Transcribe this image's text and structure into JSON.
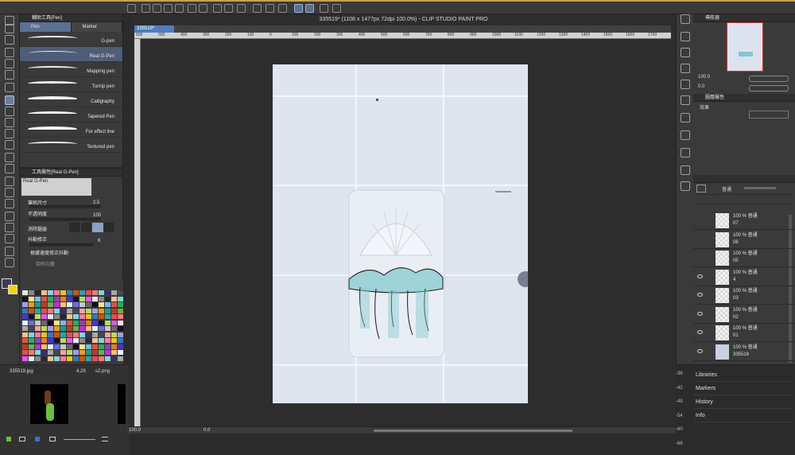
{
  "app": {
    "document_title": "335519* (1108 x 1477px 72dpi 100.0%)  - CLIP STUDIO PAINT PRO",
    "doc_tab": "335519*"
  },
  "subtool_panel": {
    "title": "輔助工具[Pen]",
    "tabs": [
      "Pen",
      "Marker"
    ],
    "active_tab": 0,
    "brushes": [
      "G-pen",
      "Real G-Pen",
      "Mapping pen",
      "Turnip pen",
      "Calligraphy",
      "Tapered Pen",
      "For effect line",
      "Textured pen"
    ],
    "active_brush": 1
  },
  "tool_property": {
    "title": "工具屬性[Real G-Pen]",
    "preview_label": "Real G-Pen",
    "brush_size_label": "筆刷尺寸",
    "brush_size_value": "2.5",
    "opacity_label": "不透明度",
    "opacity_value": "100",
    "antialias_label": "消除鋸齒",
    "stabilize_label": "抖動修正",
    "stabilize_value": "6",
    "speed_check_label": "根據速度修正抖動",
    "vector_snap_label": "吸附向量"
  },
  "ruler_ticks": [
    "600",
    "500",
    "400",
    "300",
    "200",
    "100",
    "0",
    "100",
    "200",
    "300",
    "400",
    "500",
    "600",
    "700",
    "800",
    "900",
    "1000",
    "1100",
    "1200",
    "1300",
    "1400",
    "1500",
    "1600",
    "1700"
  ],
  "status": {
    "zoom": "100.0",
    "angle": "0.0"
  },
  "navigator": {
    "title": "導航器",
    "zoom": "100.0",
    "rotation": "0.0"
  },
  "layer_property": {
    "title": "圖層屬性",
    "effect_label": "效果"
  },
  "layer_panel": {
    "blend_mode": "普通",
    "layers": [
      {
        "opacity": "100 %",
        "mode": "普通",
        "name": "07",
        "visible": false
      },
      {
        "opacity": "100 %",
        "mode": "普通",
        "name": "06",
        "visible": false
      },
      {
        "opacity": "100 %",
        "mode": "普通",
        "name": "05",
        "visible": false
      },
      {
        "opacity": "100 %",
        "mode": "普通",
        "name": "4",
        "visible": true
      },
      {
        "opacity": "100 %",
        "mode": "普通",
        "name": "03",
        "visible": true
      },
      {
        "opacity": "100 %",
        "mode": "普通",
        "name": "02",
        "visible": true
      },
      {
        "opacity": "100 %",
        "mode": "普通",
        "name": "01",
        "visible": true
      },
      {
        "opacity": "100 %",
        "mode": "普通",
        "name": "335519",
        "visible": true
      }
    ]
  },
  "bottom_right_links": [
    "Libraries",
    "Markers",
    "History",
    "Info"
  ],
  "side_numbers": [
    "-36",
    "-42",
    "-48",
    "-54",
    "-60",
    "-66"
  ],
  "bottom_left": {
    "filename": "335519.jpg",
    "info": "4,29",
    "file2": "s2.png"
  },
  "colors": {
    "accent": "#5c7091",
    "tab_blue": "#4d7ebf",
    "main_color": "#3b3b55",
    "sub_color": "#f2d400"
  }
}
